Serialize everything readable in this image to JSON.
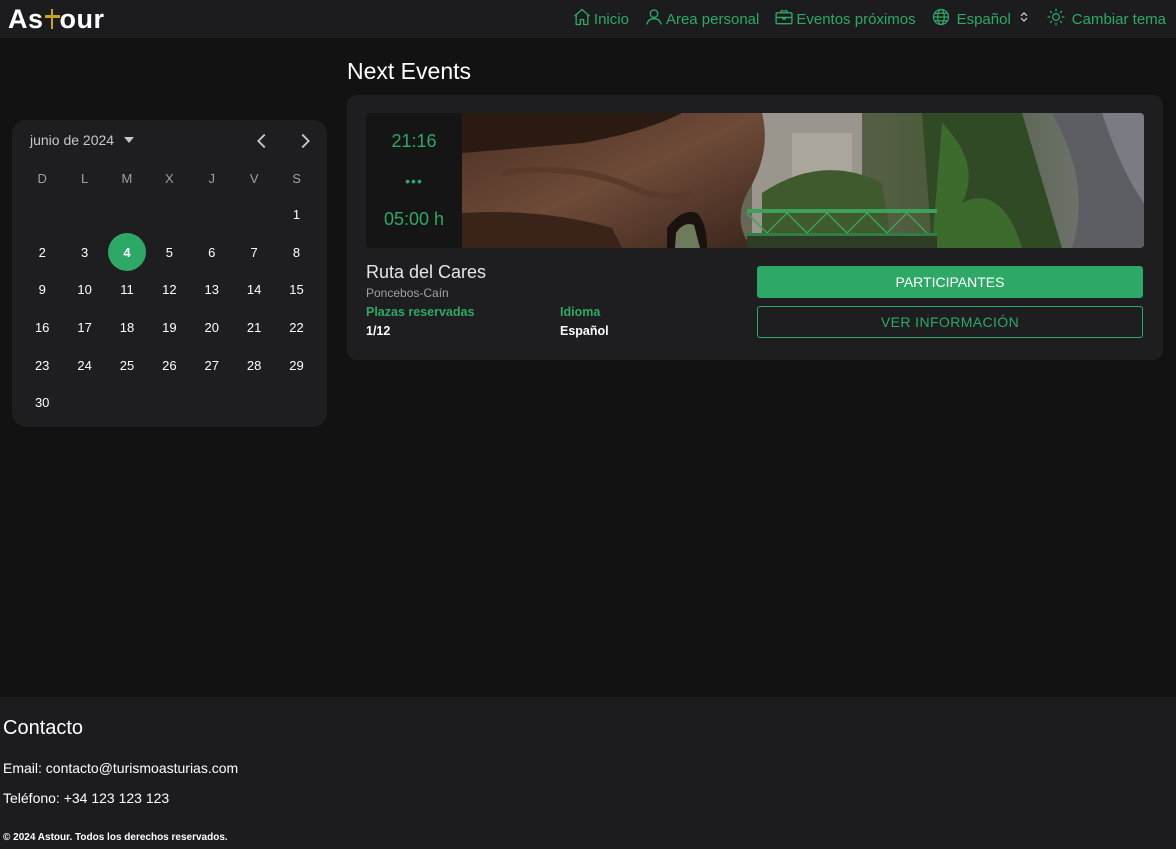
{
  "brand": {
    "logo_left": "As",
    "logo_right": "our"
  },
  "nav": {
    "home_label": "Inicio",
    "personal_label": "Area personal",
    "events_label": "Eventos próximos",
    "language_label": "Español",
    "theme_label": "Cambiar tema",
    "accent_color": "#2ea866"
  },
  "calendar": {
    "month_label": "junio de 2024",
    "weekdays": [
      "D",
      "L",
      "M",
      "X",
      "J",
      "V",
      "S"
    ],
    "leading_blanks": 6,
    "days_in_month": 30,
    "selected_day": 4
  },
  "main": {
    "title": "Next Events"
  },
  "event": {
    "start_time": "21:16",
    "dots": "•••",
    "duration": "05:00 h",
    "name": "Ruta del Cares",
    "location": "Poncebos-Caín",
    "seats_label": "Plazas reservadas",
    "seats_value": "1/12",
    "language_label": "Idioma",
    "language_value": "Español",
    "participants_button": "PARTICIPANTES",
    "info_button": "VER INFORMACIÓN"
  },
  "footer": {
    "title": "Contacto",
    "email": "Email: contacto@turismoasturias.com",
    "phone": "Teléfono: +34 123 123 123",
    "copyright": "© 2024 Astour. Todos los derechos reservados."
  }
}
